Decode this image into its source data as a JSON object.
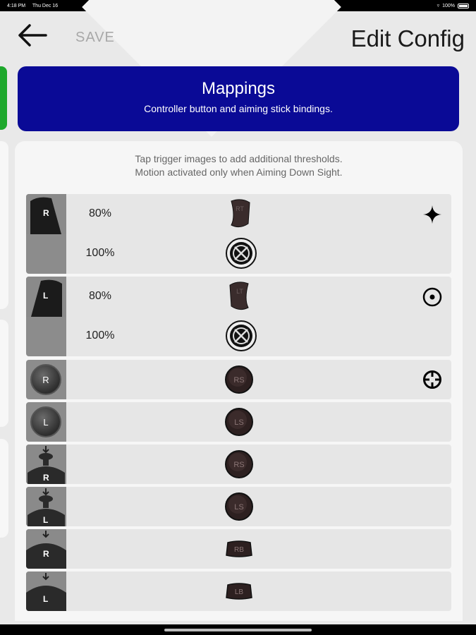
{
  "status": {
    "time": "4:18 PM",
    "date": "Thu Dec 16",
    "battery": "100%"
  },
  "header": {
    "save_label": "SAVE",
    "title": "Edit Config"
  },
  "banner": {
    "title": "Mappings",
    "subtitle": "Controller button and aiming stick bindings."
  },
  "info": {
    "line1": "Tap trigger images to add additional thresholds.",
    "line2": "Motion activated only when Aiming Down Sight."
  },
  "rows": [
    {
      "thumb": "R",
      "thresholds": [
        {
          "pct": "80%",
          "button": "RT"
        },
        {
          "pct": "100%",
          "button": "xbox"
        }
      ],
      "side_icon": "sparkle-icon"
    },
    {
      "thumb": "L",
      "thresholds": [
        {
          "pct": "80%",
          "button": "LT"
        },
        {
          "pct": "100%",
          "button": "xbox"
        }
      ],
      "side_icon": "target-dot-icon"
    },
    {
      "thumb": "R",
      "button": "RS",
      "side_icon": "crosshair-icon"
    },
    {
      "thumb": "L",
      "button": "LS"
    },
    {
      "thumb": "R",
      "button": "RS"
    },
    {
      "thumb": "L",
      "button": "LS"
    },
    {
      "thumb": "R",
      "button": "RB"
    },
    {
      "thumb": "L",
      "button": "LB"
    }
  ],
  "colors": {
    "banner": "#0a0a96",
    "accent_green": "#1ea82c",
    "row_bg": "#e6e6e6"
  }
}
